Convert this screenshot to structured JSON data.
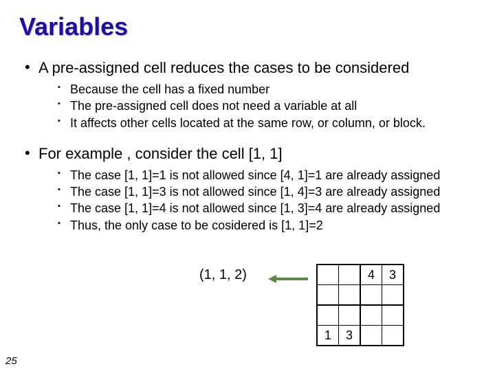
{
  "title": "Variables",
  "bullets": [
    {
      "text": "A pre-assigned cell reduces the cases to be considered",
      "sub": [
        "Because the cell has a fixed number",
        "The pre-assigned cell does not need a variable at all",
        "It affects other cells located at the same row, or column, or block."
      ]
    },
    {
      "text": "For example , consider the cell [1, 1]",
      "sub": [
        "The case [1, 1]=1 is not allowed since [4, 1]=1 are already assigned",
        "The case [1, 1]=3 is not allowed since [1, 4]=3 are already assigned",
        "The case [1, 1]=4 is not allowed since [1, 3]=4 are already assigned",
        "Thus, the only case to be cosidered is [1, 1]=2"
      ]
    }
  ],
  "figure": {
    "tuple": "(1, 1, 2)",
    "grid": [
      [
        "",
        "",
        "4",
        "3"
      ],
      [
        "",
        "",
        "",
        ""
      ],
      [
        "",
        "",
        "",
        ""
      ],
      [
        "1",
        "3",
        "",
        ""
      ]
    ]
  },
  "page_number": "25"
}
